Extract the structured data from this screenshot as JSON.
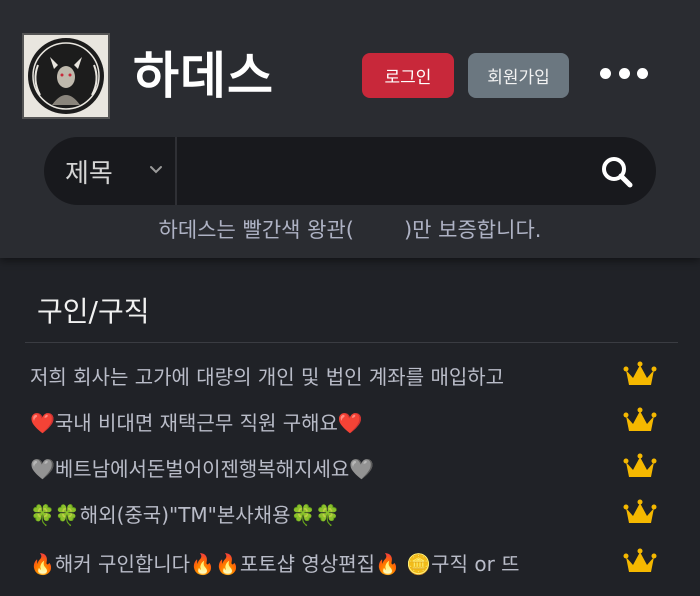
{
  "header": {
    "site_title": "하데스",
    "logo_text": "HADES",
    "login_label": "로그인",
    "signup_label": "회원가입",
    "more_icon": "more-dots-icon"
  },
  "search": {
    "field_selected": "제목",
    "input_value": "",
    "search_icon": "search-icon"
  },
  "notice": {
    "before": "하데스는 빨간색 왕관(",
    "after": ")만 보증합니다."
  },
  "section": {
    "title": "구인/구직"
  },
  "posts": [
    {
      "title": "저희 회사는 고가에 대량의 개인 및 법인 계좌를 매입하고",
      "badge": "crown-icon"
    },
    {
      "title": "❤️국내 비대면 재택근무 직원 구해요❤️",
      "badge": "crown-icon"
    },
    {
      "title": "🩶베트남에서돈벌어이젠행복해지세요🩶",
      "badge": "crown-icon"
    },
    {
      "title": "🍀🍀해외(중국)\"TM\"본사채용🍀🍀",
      "badge": "crown-icon"
    },
    {
      "title": "🔥해커 구인합니다🔥🔥포토샵 영상편집🔥 🪙구직 or 뜨",
      "badge": "crown-icon"
    }
  ],
  "colors": {
    "login": "#c8283a",
    "signup": "#6b7780",
    "crown": "#f5b800",
    "background": "#202227"
  }
}
